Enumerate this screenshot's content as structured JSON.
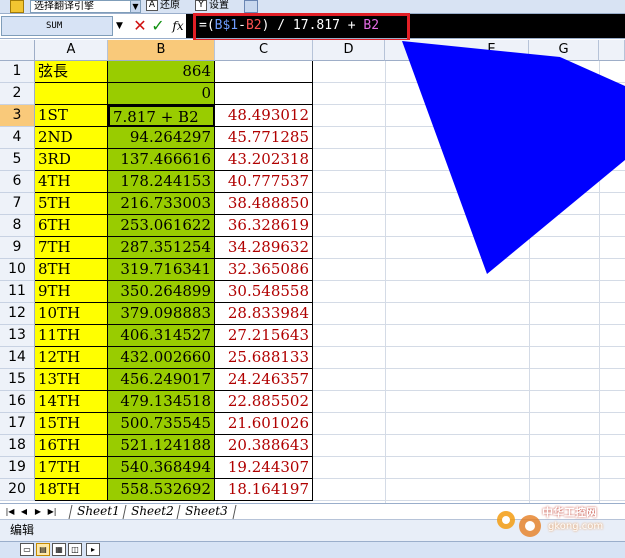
{
  "toolbar": {
    "combo_value": "选择翻译引擎",
    "restore_label": "还原",
    "settings_label": "设置"
  },
  "formula_bar": {
    "name_box": "SUM",
    "eq": "=",
    "open": "(",
    "ref_b1": "B$1",
    "minus": "-",
    "ref_b2": "B2",
    "rest": ") / 17.817 + ",
    "ref_b2_second": "B2"
  },
  "columns": [
    "A",
    "B",
    "C",
    "D",
    "E",
    "G"
  ],
  "rows": [
    {
      "n": "1",
      "a": "弦長",
      "b": "864",
      "c": ""
    },
    {
      "n": "2",
      "a": "",
      "b": "0",
      "c": ""
    },
    {
      "n": "3",
      "a": "1ST",
      "b": "7.817 + B2",
      "c": "48.493012"
    },
    {
      "n": "4",
      "a": "2ND",
      "b": "94.264297",
      "c": "45.771285"
    },
    {
      "n": "5",
      "a": "3RD",
      "b": "137.466616",
      "c": "43.202318"
    },
    {
      "n": "6",
      "a": "4TH",
      "b": "178.244153",
      "c": "40.777537"
    },
    {
      "n": "7",
      "a": "5TH",
      "b": "216.733003",
      "c": "38.488850"
    },
    {
      "n": "8",
      "a": "6TH",
      "b": "253.061622",
      "c": "36.328619"
    },
    {
      "n": "9",
      "a": "7TH",
      "b": "287.351254",
      "c": "34.289632"
    },
    {
      "n": "10",
      "a": "8TH",
      "b": "319.716341",
      "c": "32.365086"
    },
    {
      "n": "11",
      "a": "9TH",
      "b": "350.264899",
      "c": "30.548558"
    },
    {
      "n": "12",
      "a": "10TH",
      "b": "379.098883",
      "c": "28.833984"
    },
    {
      "n": "13",
      "a": "11TH",
      "b": "406.314527",
      "c": "27.215643"
    },
    {
      "n": "14",
      "a": "12TH",
      "b": "432.002660",
      "c": "25.688133"
    },
    {
      "n": "15",
      "a": "13TH",
      "b": "456.249017",
      "c": "24.246357"
    },
    {
      "n": "16",
      "a": "14TH",
      "b": "479.134518",
      "c": "22.885502"
    },
    {
      "n": "17",
      "a": "15TH",
      "b": "500.735545",
      "c": "21.601026"
    },
    {
      "n": "18",
      "a": "16TH",
      "b": "521.124188",
      "c": "20.388643"
    },
    {
      "n": "19",
      "a": "17TH",
      "b": "540.368494",
      "c": "19.244307"
    },
    {
      "n": "20",
      "a": "18TH",
      "b": "558.532692",
      "c": "18.164197"
    }
  ],
  "sheets": [
    "Sheet1",
    "Sheet2",
    "Sheet3"
  ],
  "status_text": "编辑",
  "watermark": {
    "title": "中华工控网",
    "url": "gkong.com"
  },
  "colors": {
    "label_fill": "#ffff00",
    "value_fill": "#99cc00",
    "result_text": "#b00000",
    "arrow": "#0000ff",
    "highlight": "#e21f26"
  }
}
